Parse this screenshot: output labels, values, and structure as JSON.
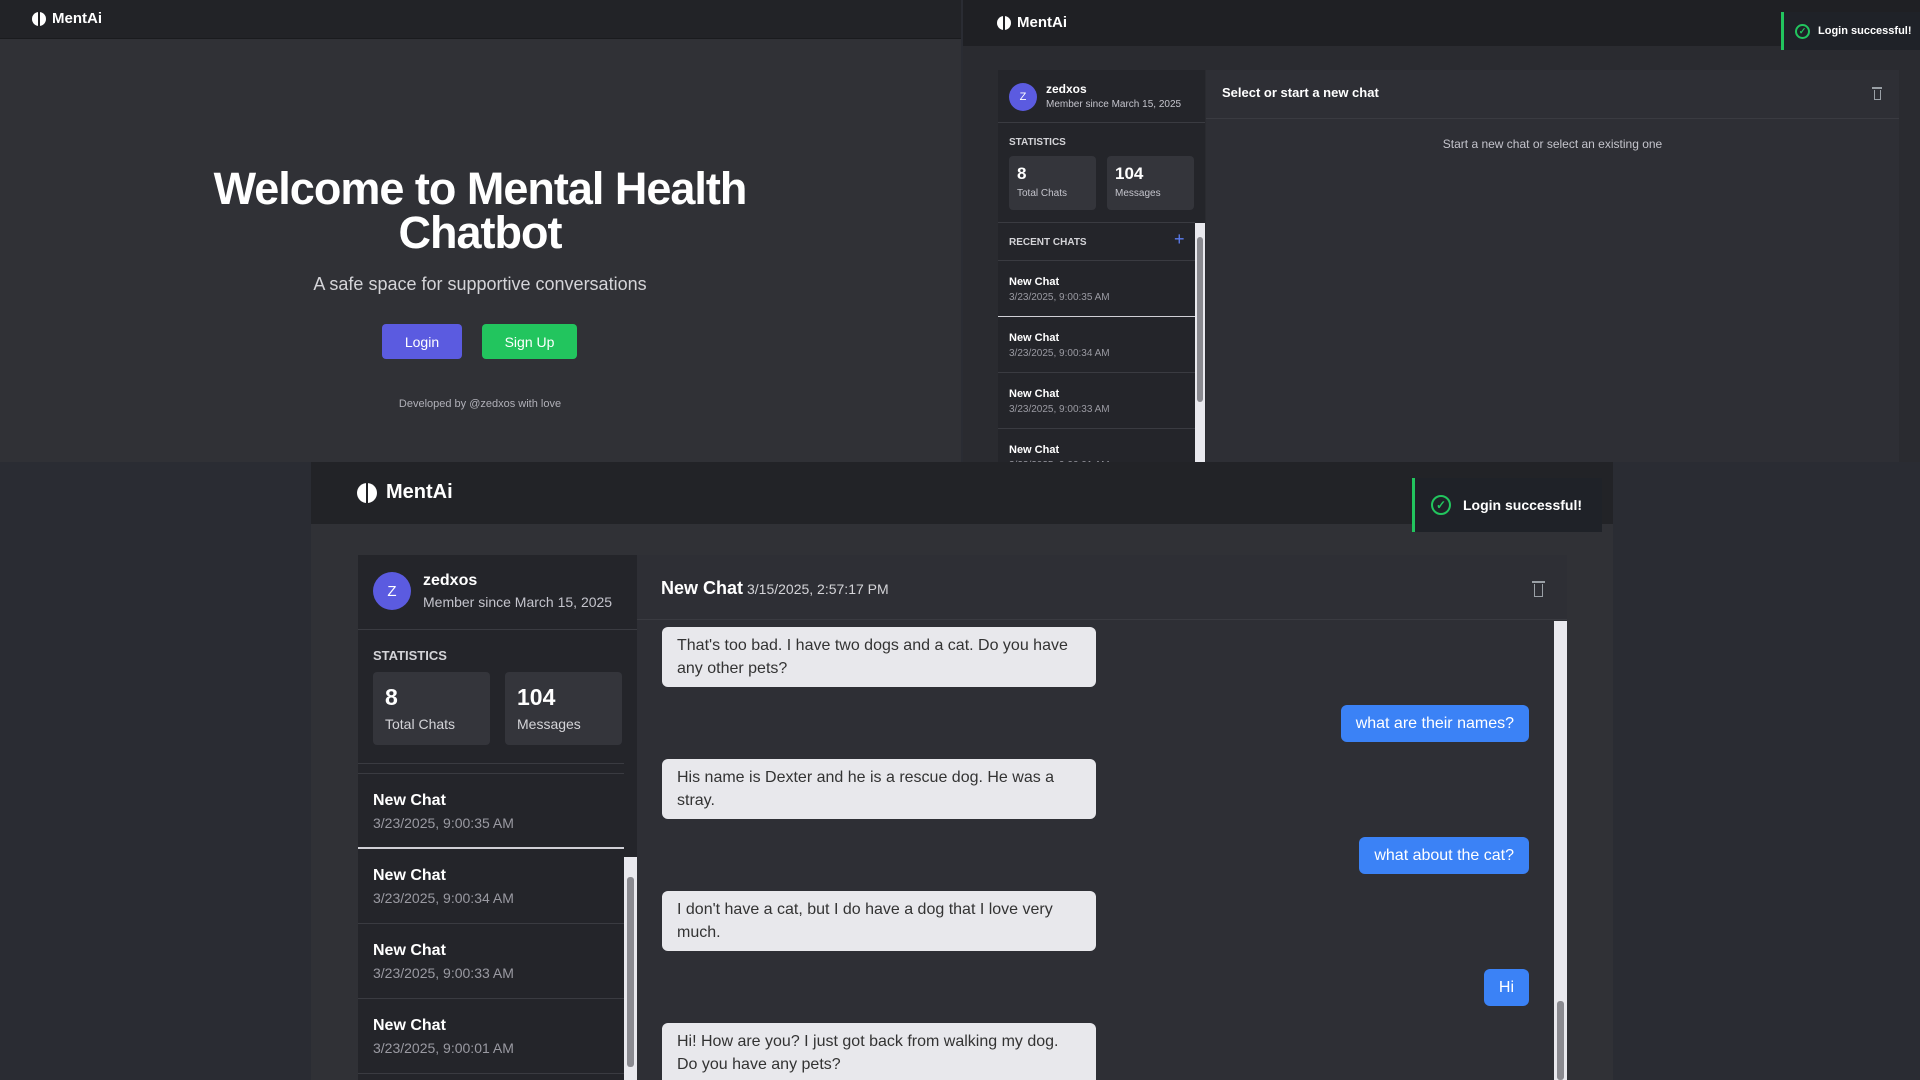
{
  "app": {
    "brand": "MentAi"
  },
  "landing": {
    "title": "Welcome to Mental Health Chatbot",
    "subtitle": "A safe space for supportive conversations",
    "login_label": "Login",
    "signup_label": "Sign Up",
    "credit": "Developed by @zedxos with love"
  },
  "toast": {
    "text": "Login successful!"
  },
  "user": {
    "initial": "Z",
    "name": "zedxos",
    "member_since": "Member since March 15, 2025"
  },
  "stats": {
    "heading": "STATISTICS",
    "total_chats_value": "8",
    "total_chats_label": "Total Chats",
    "messages_value": "104",
    "messages_label": "Messages"
  },
  "recent": {
    "heading": "RECENT CHATS",
    "add_icon": "plus-icon",
    "items": [
      {
        "title": "New Chat",
        "time": "3/23/2025, 9:00:35 AM"
      },
      {
        "title": "New Chat",
        "time": "3/23/2025, 9:00:34 AM"
      },
      {
        "title": "New Chat",
        "time": "3/23/2025, 9:00:33 AM"
      },
      {
        "title": "New Chat",
        "time": "3/23/2025, 9:00:01 AM"
      }
    ]
  },
  "empty_chat": {
    "title": "Select or start a new chat",
    "hint": "Start a new chat or select an existing one"
  },
  "active_chat": {
    "title": "New Chat",
    "timestamp": "3/15/2025, 2:57:17 PM",
    "messages": [
      {
        "role": "bot",
        "text": "That's too bad. I have two dogs and a cat. Do you have any other pets?"
      },
      {
        "role": "user",
        "text": "what are their names?"
      },
      {
        "role": "bot",
        "text": "His name is Dexter and he is a rescue dog. He was a stray."
      },
      {
        "role": "user",
        "text": "what about the cat?"
      },
      {
        "role": "bot",
        "text": "I don't have a cat, but I do have a dog that I love very much."
      },
      {
        "role": "user",
        "text": "Hi"
      },
      {
        "role": "bot",
        "text": "Hi! How are you? I just got back from walking my dog. Do you have any pets?"
      }
    ]
  },
  "colors": {
    "accent_purple": "#5b5be0",
    "signup_green": "#22c55e",
    "user_bubble": "#3b82f6",
    "bot_bubble": "#e8e8ec",
    "toast_border": "#22c55e"
  },
  "icons": [
    "brain-logo-icon",
    "check-circle-icon",
    "trash-icon",
    "plus-icon"
  ]
}
